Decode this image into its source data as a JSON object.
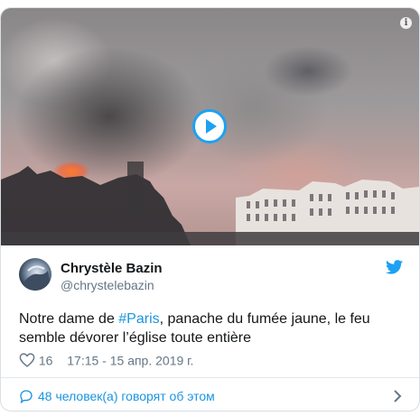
{
  "tweet": {
    "author_name": "Chrystèle Bazin",
    "author_handle": "@chrystelebazin",
    "text_before": "Notre dame de ",
    "hashtag": "#Paris",
    "text_after": ", panache du fumée jaune, le feu semble dévorer l’église toute entière",
    "like_count": "16",
    "timestamp": "17:15 - 15 апр. 2019 г.",
    "conversation_link": "48 человек(а) говорят об этом"
  },
  "media": {
    "type": "video",
    "play_icon": "play-icon",
    "info_icon": "info-icon"
  },
  "colors": {
    "accent": "#1da1f2",
    "link": "#1b95e0",
    "muted": "#657786",
    "border": "#d9dfe3"
  },
  "icons": {
    "brand": "twitter-bird-icon",
    "like": "heart-icon",
    "reply": "speech-bubble-icon",
    "chevron": "chevron-right-icon"
  }
}
